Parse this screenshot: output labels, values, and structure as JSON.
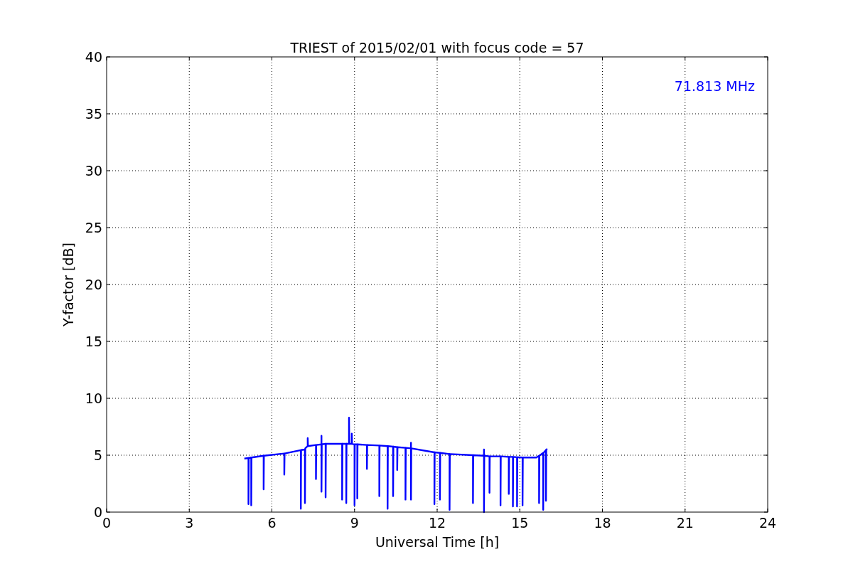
{
  "figure": {
    "chart_data": {
      "type": "line",
      "title": "TRIEST of 2015/02/01 with focus code = 57",
      "xlabel": "Universal Time [h]",
      "ylabel": "Y-factor [dB]",
      "xlim": [
        0,
        24
      ],
      "ylim": [
        0,
        40
      ],
      "xticks": [
        0,
        3,
        6,
        9,
        12,
        15,
        18,
        21,
        24
      ],
      "yticks": [
        0,
        5,
        10,
        15,
        20,
        25,
        30,
        35,
        40
      ],
      "grid": true,
      "x": [
        5.0,
        5.15,
        5.15,
        5.16,
        5.25,
        5.25,
        5.26,
        5.7,
        5.7,
        5.71,
        6.45,
        6.45,
        6.46,
        7.05,
        7.05,
        7.06,
        7.2,
        7.2,
        7.21,
        7.3,
        7.3,
        7.31,
        7.6,
        7.6,
        7.61,
        7.8,
        7.8,
        7.8,
        7.81,
        7.95,
        7.95,
        7.96,
        8.55,
        8.55,
        8.56,
        8.7,
        8.7,
        8.71,
        8.8,
        8.8,
        8.81,
        8.9,
        8.9,
        8.91,
        9.0,
        9.0,
        9.01,
        9.1,
        9.1,
        9.11,
        9.45,
        9.45,
        9.46,
        9.9,
        9.9,
        9.91,
        10.2,
        10.2,
        10.21,
        10.4,
        10.4,
        10.41,
        10.55,
        10.55,
        10.56,
        10.85,
        10.85,
        10.86,
        11.05,
        11.05,
        11.05,
        11.06,
        11.9,
        11.9,
        11.91,
        12.1,
        12.1,
        12.11,
        12.45,
        12.45,
        12.46,
        13.3,
        13.3,
        13.31,
        13.7,
        13.7,
        13.7,
        13.71,
        13.9,
        13.9,
        13.91,
        14.3,
        14.3,
        14.31,
        14.6,
        14.6,
        14.61,
        14.75,
        14.75,
        14.76,
        14.9,
        14.9,
        14.91,
        15.1,
        15.1,
        15.11,
        15.6,
        15.7,
        15.7,
        15.71,
        15.85,
        15.85,
        15.86,
        15.95,
        15.95,
        15.96,
        16.0
      ],
      "series": [
        {
          "name": "71.813 MHz",
          "color": "#0000ff",
          "values": [
            4.7,
            4.75,
            0.7,
            4.75,
            4.8,
            0.6,
            4.8,
            4.95,
            2.0,
            4.95,
            5.15,
            3.3,
            5.15,
            5.45,
            0.3,
            5.45,
            5.5,
            0.8,
            5.6,
            5.8,
            6.5,
            5.8,
            5.9,
            2.9,
            5.9,
            5.95,
            6.7,
            1.8,
            5.95,
            6.0,
            1.3,
            6.0,
            6.0,
            1.1,
            6.0,
            6.0,
            0.8,
            6.0,
            6.0,
            8.3,
            6.0,
            6.0,
            6.9,
            6.0,
            5.95,
            0.6,
            5.95,
            5.95,
            1.2,
            5.95,
            5.9,
            3.8,
            5.9,
            5.85,
            1.4,
            5.85,
            5.8,
            0.3,
            5.8,
            5.75,
            1.4,
            5.75,
            5.7,
            3.7,
            5.7,
            5.65,
            1.1,
            5.65,
            5.6,
            6.1,
            1.1,
            5.6,
            5.25,
            0.7,
            5.25,
            5.2,
            1.1,
            5.2,
            5.1,
            0.2,
            5.1,
            5.0,
            0.8,
            5.0,
            4.95,
            5.5,
            0.0,
            4.95,
            4.9,
            1.7,
            4.9,
            4.9,
            0.6,
            4.9,
            4.85,
            1.6,
            4.85,
            4.85,
            0.5,
            4.85,
            4.82,
            0.5,
            4.82,
            4.8,
            0.6,
            4.8,
            4.8,
            4.95,
            0.8,
            4.95,
            5.2,
            0.2,
            5.2,
            5.45,
            1.0,
            5.5,
            5.55
          ]
        }
      ]
    }
  }
}
